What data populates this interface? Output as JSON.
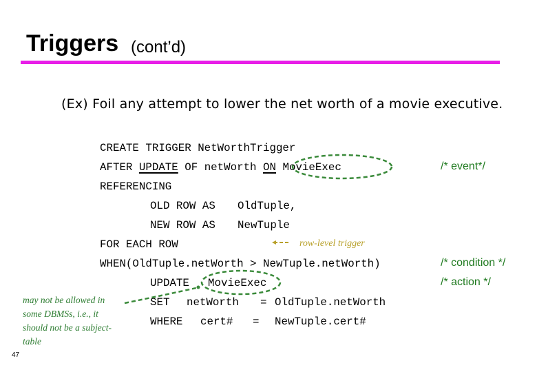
{
  "slide": {
    "title": "Triggers",
    "subtitle": "(cont’d)",
    "example": "(Ex) Foil any attempt to lower the net worth of a movie executive.",
    "accent_color": "#e81ee8",
    "page_number": "47"
  },
  "code": {
    "line1": "CREATE TRIGGER NetWorthTrigger",
    "line2": {
      "after": "AFTER ",
      "update": "UPDATE",
      "of": " OF netWorth ",
      "on": "ON",
      "table": " MovieExec"
    },
    "line3": "REFERENCING",
    "line4": {
      "left": "OLD ROW AS",
      "right": "OldTuple,"
    },
    "line5": {
      "left": "NEW ROW AS",
      "right": "NewTuple"
    },
    "line6": "FOR EACH ROW",
    "line7": "WHEN(OldTuple.netWorth > NewTuple.netWorth)",
    "line8": {
      "kw": "UPDATE",
      "table": "MovieExec"
    },
    "line9": {
      "kw": "SET",
      "col": "netWorth",
      "eq": "=",
      "val": "OldTuple.netWorth"
    },
    "line10": {
      "kw": "WHERE",
      "col": "cert#",
      "eq": "=",
      "val": "NewTuple.cert#"
    }
  },
  "comments": {
    "event": "/* event*/",
    "condition": "/* condition */",
    "action": "/* action */",
    "color": "#1f7a1f"
  },
  "annotations": {
    "row_level": "row-level trigger",
    "row_level_color": "#b8a02a",
    "subject_table_note": "may not be allowed in some DBMSs, i.e., it should not be a subject-table",
    "note_color": "#2e7d32"
  }
}
